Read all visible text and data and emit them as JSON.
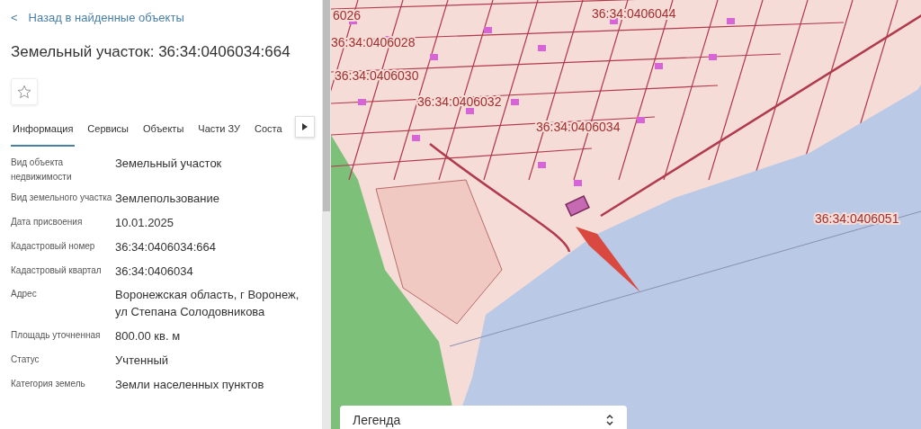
{
  "back_link": {
    "icon": "<",
    "label": "Назад в найденные объекты"
  },
  "title": "Земельный участок: 36:34:0406034:664",
  "favorite": {
    "on": false
  },
  "tabs": [
    {
      "label": "Информация",
      "selected": true
    },
    {
      "label": "Сервисы",
      "selected": false
    },
    {
      "label": "Объекты",
      "selected": false
    },
    {
      "label": "Части ЗУ",
      "selected": false
    },
    {
      "label": "Соста",
      "selected": false
    }
  ],
  "fields": [
    {
      "label": "Вид объекта недвижимости",
      "value": "Земельный участок"
    },
    {
      "label": "Вид земельного участка",
      "value": "Землепользование"
    },
    {
      "label": "Дата присвоения",
      "value": "10.01.2025"
    },
    {
      "label": "Кадастровый номер",
      "value": "36:34:0406034:664"
    },
    {
      "label": "Кадастровый квартал",
      "value": "36:34:0406034"
    },
    {
      "label": "Адрес",
      "value": "Воронежская область, г Воронеж, ул Степана Солодовникова"
    },
    {
      "label": "Площадь уточненная",
      "value": "800.00 кв. м"
    },
    {
      "label": "Статус",
      "value": "Учтенный"
    },
    {
      "label": "Категория земель",
      "value": "Земли населенных пунктов"
    }
  ],
  "map": {
    "labels": [
      "6026",
      "36:34:0406028",
      "36:34:0406030",
      "36:34:0406032",
      "36:34:0406034",
      "36:34:0406044",
      "36:34:0406051"
    ],
    "legend": {
      "label": "Легенда",
      "expanded": false
    }
  }
}
